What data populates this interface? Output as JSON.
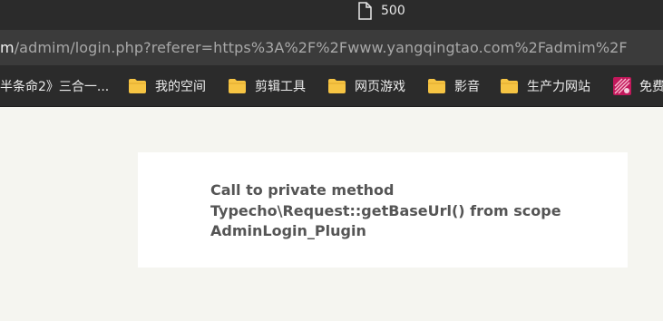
{
  "browser": {
    "tab": {
      "title": "500",
      "icon": "document-icon"
    },
    "address_bar": {
      "host_fragment": "m",
      "path": "/admim/login.php?referer=https%3A%2F%2Fwww.yangqingtao.com%2Fadmim%2F"
    },
    "bookmarks": [
      {
        "label": "半条命2》三合一...",
        "icon": null
      },
      {
        "label": "我的空间",
        "icon": "folder-icon"
      },
      {
        "label": "剪辑工具",
        "icon": "folder-icon"
      },
      {
        "label": "网页游戏",
        "icon": "folder-icon"
      },
      {
        "label": "影音",
        "icon": "folder-icon"
      },
      {
        "label": "生产力网站",
        "icon": "folder-icon"
      },
      {
        "label": "免费",
        "icon": "site-favicon-icon"
      }
    ]
  },
  "page": {
    "error_lines": [
      "Call to private method",
      "Typecho\\Request::getBaseUrl() from scope",
      "AdminLogin_Plugin"
    ]
  },
  "colors": {
    "chrome_dark": "#2b2b2b",
    "address_bar": "#3b3b3b",
    "page_bg": "#f5f5f0",
    "card_bg": "#ffffff",
    "error_text": "#555555",
    "folder": "#f6c443"
  }
}
